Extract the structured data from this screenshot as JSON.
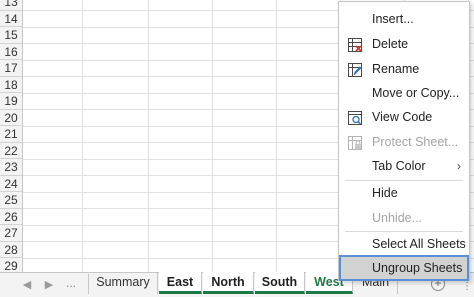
{
  "rows": [
    "13",
    "14",
    "15",
    "16",
    "17",
    "18",
    "19",
    "20",
    "21",
    "22",
    "23",
    "24",
    "25",
    "26",
    "27",
    "28",
    "29"
  ],
  "tabs": {
    "prev_arrow": "◀",
    "next_arrow": "▶",
    "ellipsis": "...",
    "sheets": [
      {
        "label": "Summary",
        "state": "normal"
      },
      {
        "label": "East",
        "state": "selected"
      },
      {
        "label": "North",
        "state": "selected"
      },
      {
        "label": "South",
        "state": "selected"
      },
      {
        "label": "West",
        "state": "active"
      },
      {
        "label": "Main",
        "state": "normal"
      }
    ],
    "add_symbol": "+",
    "split_symbol": "⋮"
  },
  "context_menu": {
    "items": [
      {
        "label": "Insert...",
        "icon": "none",
        "disabled": false
      },
      {
        "label": "Delete",
        "icon": "delete-sheet-icon",
        "disabled": false
      },
      {
        "label": "Rename",
        "icon": "rename-sheet-icon",
        "disabled": false
      },
      {
        "label": "Move or Copy...",
        "icon": "none",
        "disabled": false
      },
      {
        "label": "View Code",
        "icon": "view-code-icon",
        "disabled": false
      },
      {
        "label": "Protect Sheet...",
        "icon": "protect-sheet-icon",
        "disabled": true
      },
      {
        "label": "Tab Color",
        "icon": "none",
        "disabled": false,
        "submenu": "›"
      },
      {
        "label": "Hide",
        "icon": "none",
        "disabled": false
      },
      {
        "label": "Unhide...",
        "icon": "none",
        "disabled": true
      },
      {
        "label": "Select All Sheets",
        "icon": "none",
        "disabled": false
      },
      {
        "label": "Ungroup Sheets",
        "icon": "none",
        "disabled": false,
        "highlighted": true
      }
    ]
  },
  "colors": {
    "accent_green": "#1d7a44",
    "highlight_border": "#5b8fd6",
    "highlight_fill": "#d2d2d2",
    "delete_red": "#d23a2a"
  }
}
